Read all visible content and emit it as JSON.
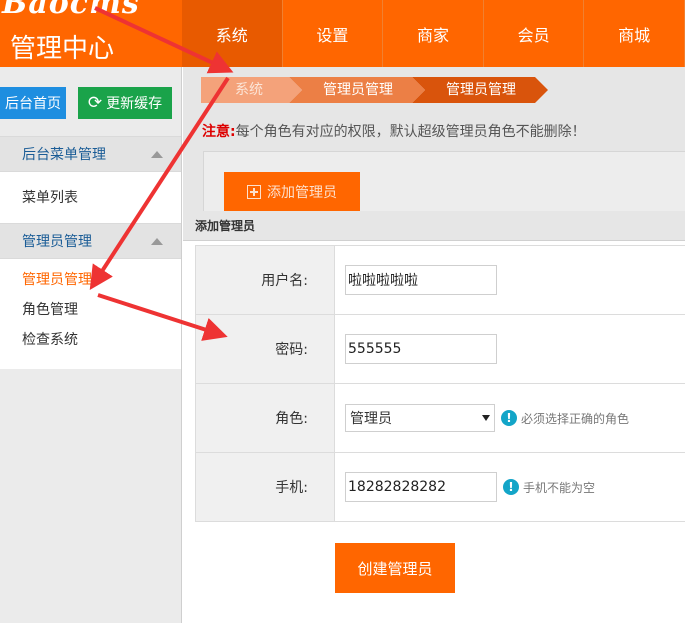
{
  "logo": {
    "brand": "Baocms",
    "title": "管理中心"
  },
  "topnav": [
    {
      "label": "系统",
      "active": true
    },
    {
      "label": "设置"
    },
    {
      "label": "商家"
    },
    {
      "label": "会员"
    },
    {
      "label": "商城"
    }
  ],
  "sidebar": {
    "home_button": "后台首页",
    "cache_button": "更新缓存",
    "groups": [
      {
        "title": "后台菜单管理",
        "items": [
          "菜单列表"
        ]
      },
      {
        "title": "管理员管理",
        "items": [
          "管理员管理",
          "角色管理",
          "检查系统"
        ]
      }
    ]
  },
  "breadcrumb": [
    "系统",
    "管理员管理",
    "管理员管理"
  ],
  "notice": {
    "label": "注意:",
    "text": "每个角色有对应的权限，默认超级管理员角色不能删除！"
  },
  "add_button": "添加管理员",
  "dialog": {
    "title": "添加管理员",
    "fields": {
      "username": {
        "label": "用户名:",
        "value": "啦啦啦啦啦"
      },
      "password": {
        "label": "密码:",
        "value": "555555"
      },
      "role": {
        "label": "角色:",
        "value": "管理员",
        "hint": "必须选择正确的角色"
      },
      "phone": {
        "label": "手机:",
        "value": "18282828282",
        "hint": "手机不能为空"
      }
    },
    "submit": "创建管理员"
  },
  "colors": {
    "accent": "#ff6600",
    "home_button": "#1e8ee0",
    "cache_button": "#1aa34a",
    "annotation": "#ee3333"
  }
}
